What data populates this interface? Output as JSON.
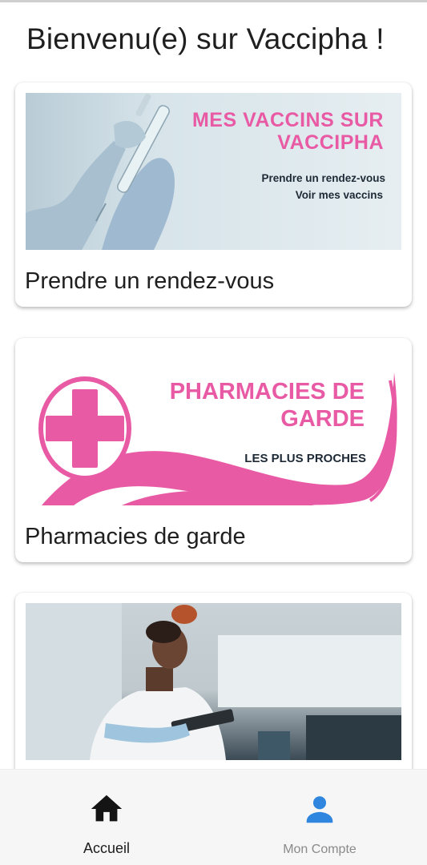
{
  "page": {
    "title": "Bienvenu(e) sur Vaccipha !"
  },
  "cards": [
    {
      "label": "Prendre un rendez-vous",
      "banner": {
        "title": "MES VACCINS SUR VACCIPHA",
        "links": [
          "Prendre un rendez-vous",
          "Voir mes vaccins"
        ]
      }
    },
    {
      "label": "Pharmacies de garde",
      "banner": {
        "title": "PHARMACIES DE GARDE",
        "subtitle": "LES PLUS PROCHES"
      }
    },
    {
      "label": "",
      "banner": {}
    }
  ],
  "bottom_nav": {
    "items": [
      {
        "label": "Accueil",
        "icon": "home-icon",
        "active": true
      },
      {
        "label": "Mon Compte",
        "icon": "account-icon",
        "active": false
      }
    ]
  },
  "colors": {
    "accent_pink": "#e95aa5",
    "account_icon_blue": "#2e86de",
    "text_dark": "#1f1f1f"
  }
}
